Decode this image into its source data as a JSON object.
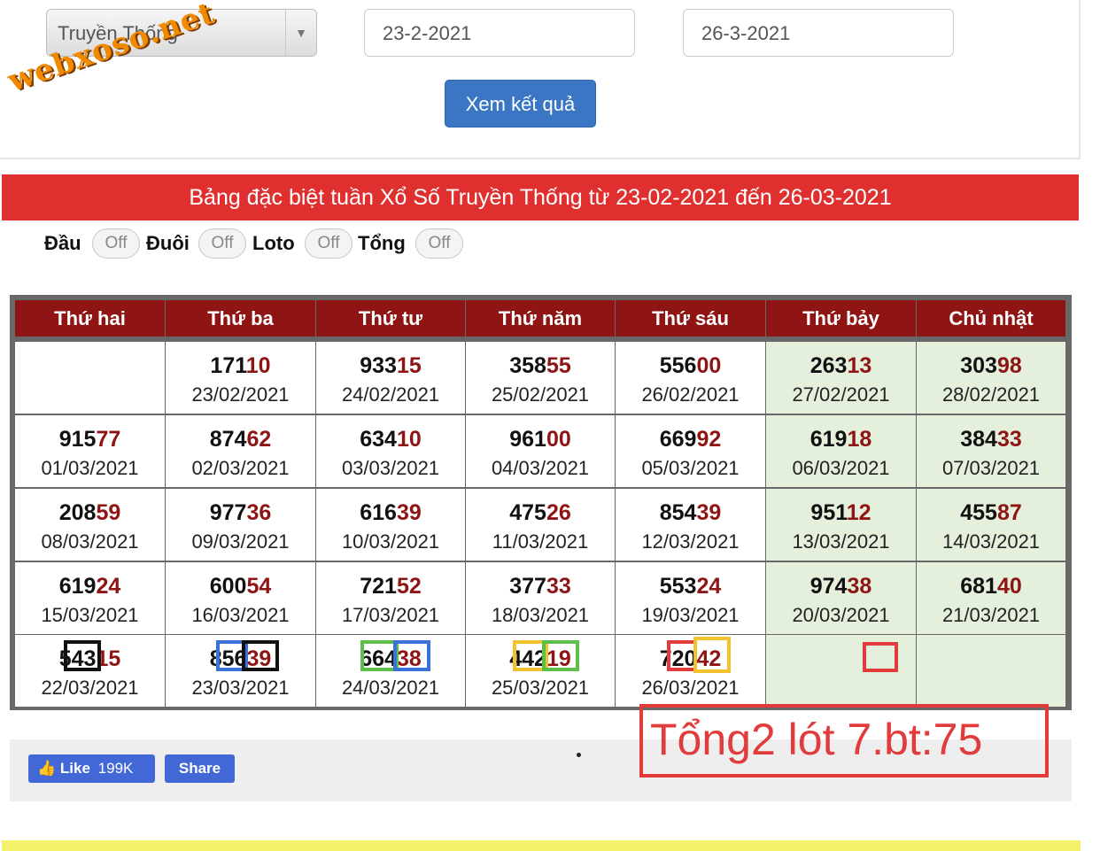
{
  "filter": {
    "lottery_type": "Truyền Thống",
    "watermark": "webxoso.net",
    "date_from": "23-2-2021",
    "date_to": "26-3-2021",
    "submit_label": "Xem kết quả"
  },
  "banner": {
    "title": "Bảng đặc biệt tuần Xổ Số Truyền Thống từ 23-02-2021 đến 26-03-2021"
  },
  "toggles": [
    {
      "label": "Đầu",
      "state": "Off"
    },
    {
      "label": "Đuôi",
      "state": "Off"
    },
    {
      "label": "Loto",
      "state": "Off"
    },
    {
      "label": "Tổng",
      "state": "Off"
    }
  ],
  "table": {
    "headers": [
      "Thứ hai",
      "Thứ ba",
      "Thứ tư",
      "Thứ năm",
      "Thứ sáu",
      "Thứ bảy",
      "Chủ nhật"
    ],
    "rows": [
      [
        {
          "head": "",
          "tail": "",
          "date": ""
        },
        {
          "head": "171",
          "tail": "10",
          "date": "23/02/2021"
        },
        {
          "head": "933",
          "tail": "15",
          "date": "24/02/2021"
        },
        {
          "head": "358",
          "tail": "55",
          "date": "25/02/2021"
        },
        {
          "head": "556",
          "tail": "00",
          "date": "26/02/2021"
        },
        {
          "head": "263",
          "tail": "13",
          "date": "27/02/2021"
        },
        {
          "head": "303",
          "tail": "98",
          "date": "28/02/2021"
        }
      ],
      [
        {
          "head": "915",
          "tail": "77",
          "date": "01/03/2021"
        },
        {
          "head": "874",
          "tail": "62",
          "date": "02/03/2021"
        },
        {
          "head": "634",
          "tail": "10",
          "date": "03/03/2021"
        },
        {
          "head": "961",
          "tail": "00",
          "date": "04/03/2021"
        },
        {
          "head": "669",
          "tail": "92",
          "date": "05/03/2021"
        },
        {
          "head": "619",
          "tail": "18",
          "date": "06/03/2021"
        },
        {
          "head": "384",
          "tail": "33",
          "date": "07/03/2021"
        }
      ],
      [
        {
          "head": "208",
          "tail": "59",
          "date": "08/03/2021"
        },
        {
          "head": "977",
          "tail": "36",
          "date": "09/03/2021"
        },
        {
          "head": "616",
          "tail": "39",
          "date": "10/03/2021"
        },
        {
          "head": "475",
          "tail": "26",
          "date": "11/03/2021"
        },
        {
          "head": "854",
          "tail": "39",
          "date": "12/03/2021"
        },
        {
          "head": "951",
          "tail": "12",
          "date": "13/03/2021"
        },
        {
          "head": "455",
          "tail": "87",
          "date": "14/03/2021"
        }
      ],
      [
        {
          "head": "619",
          "tail": "24",
          "date": "15/03/2021"
        },
        {
          "head": "600",
          "tail": "54",
          "date": "16/03/2021"
        },
        {
          "head": "721",
          "tail": "52",
          "date": "17/03/2021"
        },
        {
          "head": "377",
          "tail": "33",
          "date": "18/03/2021"
        },
        {
          "head": "553",
          "tail": "24",
          "date": "19/03/2021"
        },
        {
          "head": "974",
          "tail": "38",
          "date": "20/03/2021"
        },
        {
          "head": "681",
          "tail": "40",
          "date": "21/03/2021"
        }
      ],
      [
        {
          "head": "543",
          "tail": "15",
          "date": "22/03/2021"
        },
        {
          "head": "856",
          "tail": "39",
          "date": "23/03/2021"
        },
        {
          "head": "664",
          "tail": "38",
          "date": "24/03/2021"
        },
        {
          "head": "442",
          "tail": "19",
          "date": "25/03/2021"
        },
        {
          "head": "720",
          "tail": "42",
          "date": "26/03/2021"
        },
        {
          "head": "",
          "tail": "",
          "date": ""
        },
        {
          "head": "",
          "tail": "",
          "date": ""
        }
      ]
    ]
  },
  "social": {
    "like_label": "Like",
    "like_count": "199K",
    "share_label": "Share"
  },
  "annotation": {
    "text": "Tổng2 lót 7.bt:75"
  },
  "colors": {
    "banner": "#e02f2f",
    "header": "#8f1414",
    "weekend_cell": "#e4efdc",
    "button": "#3a76c4",
    "annotation": "#e23b3b"
  }
}
